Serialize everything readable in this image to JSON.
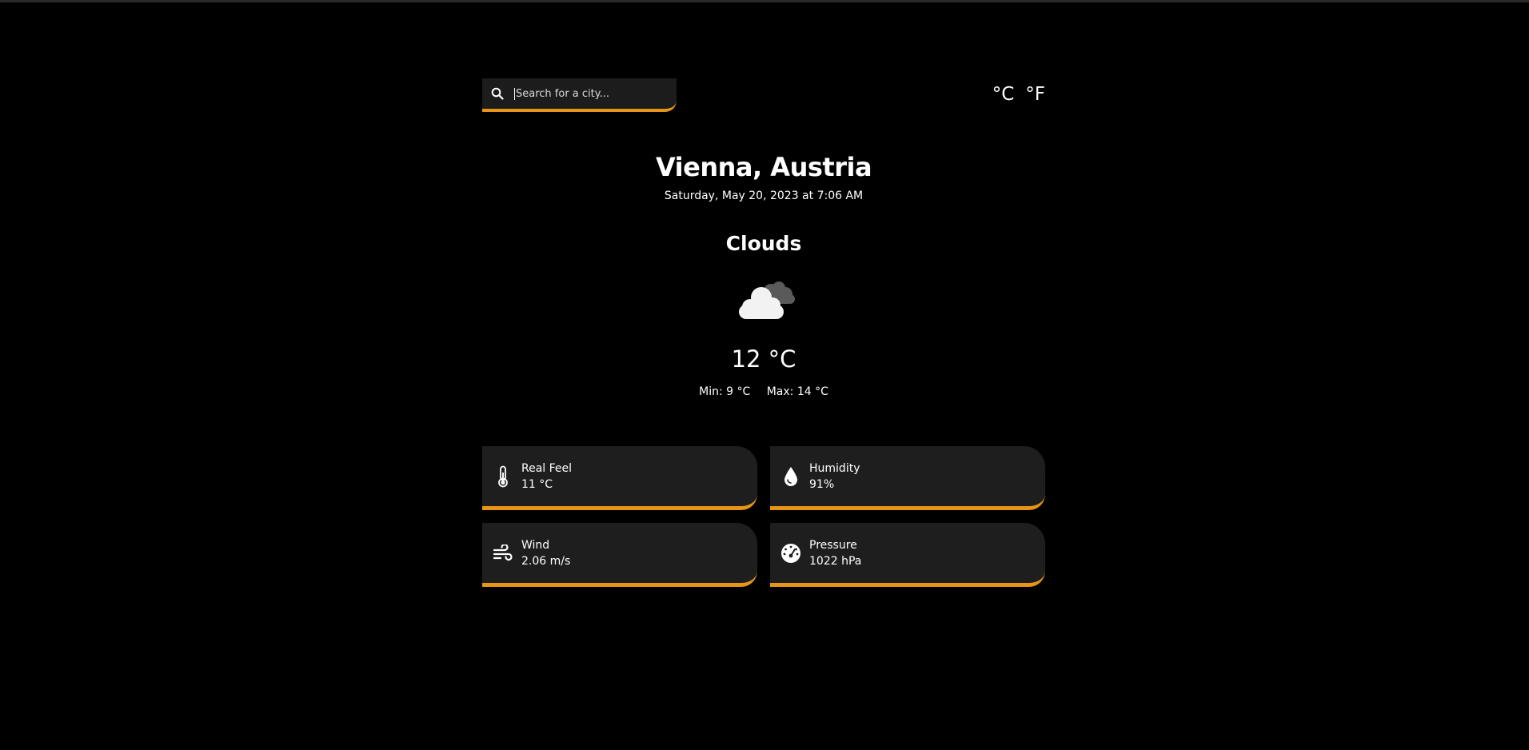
{
  "search": {
    "placeholder": "Search for a city..."
  },
  "units": {
    "celsius": "°C",
    "fahrenheit": "°F"
  },
  "location": {
    "city": "Vienna, Austria",
    "datetime": "Saturday, May 20, 2023 at 7:06 AM"
  },
  "weather": {
    "condition": "Clouds",
    "icon": "cloud-icon",
    "temperature": "12 °C",
    "min": "Min: 9 °C",
    "max": "Max: 14 °C"
  },
  "details": {
    "real_feel": {
      "label": "Real Feel",
      "value": "11 °C",
      "icon": "thermometer-icon"
    },
    "humidity": {
      "label": "Humidity",
      "value": "91%",
      "icon": "droplet-icon"
    },
    "wind": {
      "label": "Wind",
      "value": "2.06 m/s",
      "icon": "wind-icon"
    },
    "pressure": {
      "label": "Pressure",
      "value": "1022 hPa",
      "icon": "gauge-icon"
    }
  },
  "colors": {
    "accent": "#e69516",
    "card": "#1e1e1e",
    "background": "#000000"
  }
}
